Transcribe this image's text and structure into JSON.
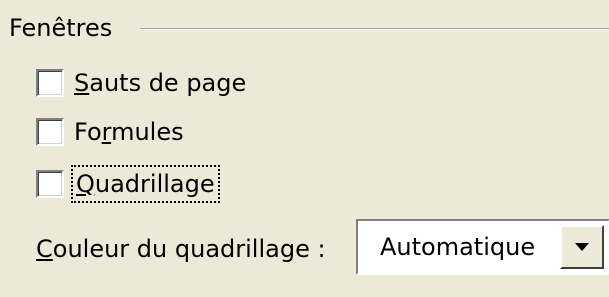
{
  "group": {
    "title": "Fenêtres"
  },
  "checkboxes": [
    {
      "pre": "",
      "accel": "S",
      "post": "auts de page",
      "checked": false
    },
    {
      "pre": "Fo",
      "accel": "r",
      "post": "mules",
      "checked": false
    },
    {
      "pre": "",
      "accel": "Q",
      "post": "uadrillage",
      "checked": false,
      "focused": true
    }
  ],
  "gridline_color": {
    "label_accel": "C",
    "label_rest": "ouleur du quadrillage :",
    "value": "Automatique"
  }
}
